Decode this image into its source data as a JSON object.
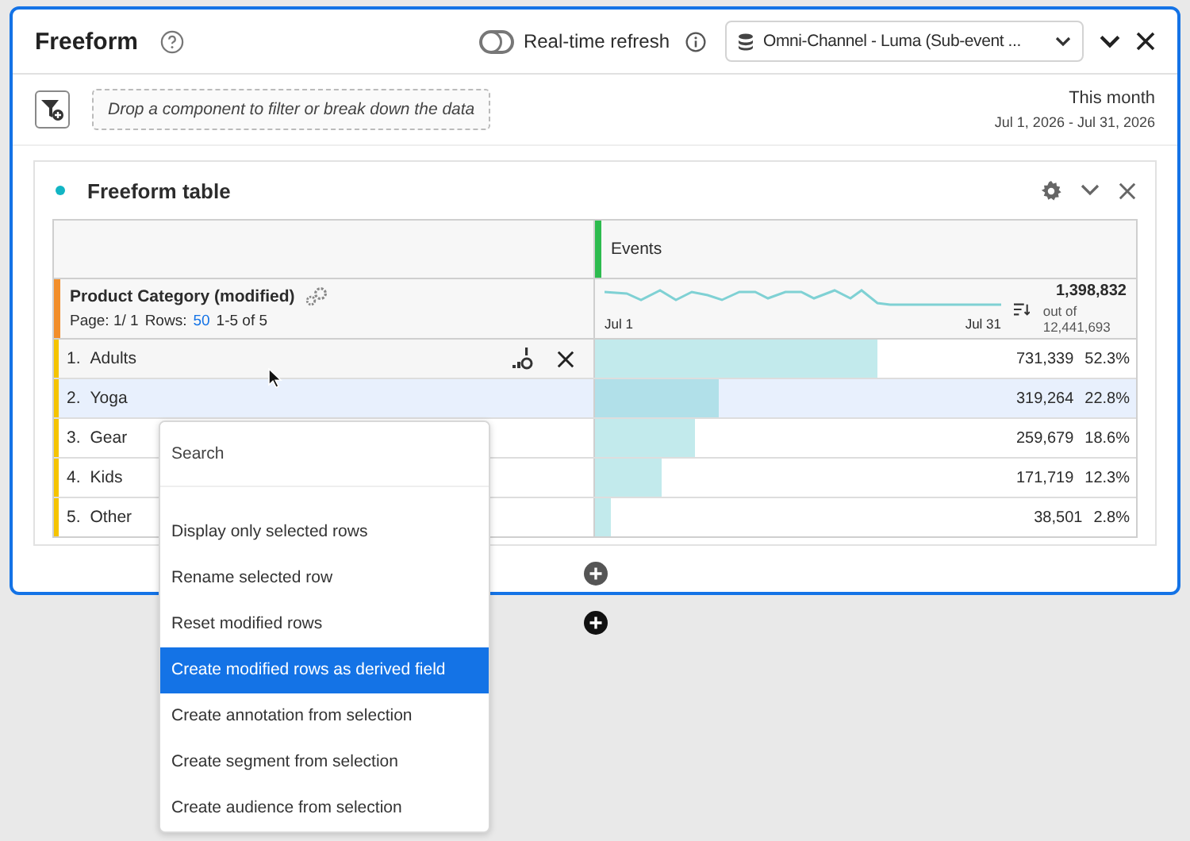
{
  "window": {
    "title": "Freeform",
    "realtime": {
      "label": "Real-time refresh",
      "on": false
    },
    "data_view": "Omni-Channel - Luma (Sub-event ..."
  },
  "filter_bar": {
    "placeholder": "Drop a component to filter or break down the data",
    "date_label": "This month",
    "date_range": "Jul 1, 2026 - Jul 31, 2026"
  },
  "panel": {
    "title": "Freeform table",
    "table": {
      "metric": "Events",
      "dimension": "Product Category (modified)",
      "page": "Page: 1/ 1",
      "rows_label": "Rows:",
      "rows_count": "50",
      "rows_range": "1-5 of 5",
      "spark_start": "Jul 1",
      "spark_end": "Jul 31",
      "total": "1,398,832",
      "total_of": "out of 12,441,693",
      "rows": [
        {
          "index": "1.",
          "name": "Adults",
          "value": "731,339",
          "percent": "52.3%",
          "level": 0.523,
          "selected": false,
          "hovered": true
        },
        {
          "index": "2.",
          "name": "Yoga",
          "value": "319,264",
          "percent": "22.8%",
          "level": 0.228,
          "selected": true,
          "hovered": false
        },
        {
          "index": "3.",
          "name": "Gear",
          "value": "259,679",
          "percent": "18.6%",
          "level": 0.186,
          "selected": false,
          "hovered": false
        },
        {
          "index": "4.",
          "name": "Kids",
          "value": "171,719",
          "percent": "12.3%",
          "level": 0.123,
          "selected": false,
          "hovered": false
        },
        {
          "index": "5.",
          "name": "Other",
          "value": "38,501",
          "percent": "2.8%",
          "level": 0.028,
          "selected": false,
          "hovered": false
        }
      ]
    }
  },
  "context_menu": {
    "placeholder": "Search",
    "items": [
      {
        "label": "Display only selected rows",
        "selected": false
      },
      {
        "label": "Rename selected row",
        "selected": false
      },
      {
        "label": "Reset modified rows",
        "selected": false
      },
      {
        "label": "Create modified rows as derived field",
        "selected": true
      },
      {
        "label": "Create annotation from selection",
        "selected": false
      },
      {
        "label": "Create segment from selection",
        "selected": false
      },
      {
        "label": "Create audience from selection",
        "selected": false
      }
    ]
  }
}
